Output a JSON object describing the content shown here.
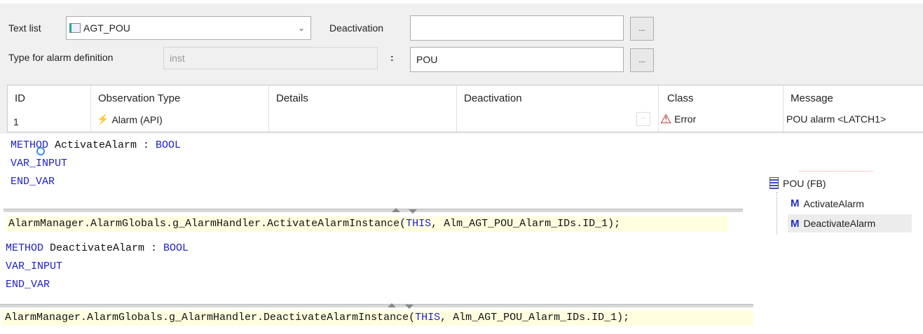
{
  "form": {
    "text_list_label": "Text list",
    "text_list_value": "AGT_POU",
    "deactivation_label": "Deactivation",
    "deactivation_value": "",
    "type_label": "Type for alarm definition",
    "type_value": "inst",
    "colon": ":",
    "pou_value": "POU",
    "dots": "..."
  },
  "table": {
    "columns": [
      "ID",
      "Observation Type",
      "Details",
      "Deactivation",
      "Class",
      "Message"
    ],
    "rows": [
      {
        "id": "1",
        "observation_type": "Alarm (API)",
        "details": "",
        "deactivation": "",
        "class": "Error",
        "message": "POU alarm <LATCH1>"
      }
    ]
  },
  "code": {
    "method1": {
      "kw": "METHOD",
      "name": " ActivateAlarm : ",
      "type": "BOOL",
      "var_input": "VAR_INPUT",
      "end_var": "END_VAR",
      "impl_a": "AlarmManager.AlarmGlobals.g_AlarmHandler.ActivateAlarmInstance(",
      "impl_this": "THIS",
      "impl_b": ", Alm_AGT_POU_Alarm_IDs.ID_1);"
    },
    "method2": {
      "kw": "METHOD",
      "name": " DeactivateAlarm : ",
      "type": "BOOL",
      "var_input": "VAR_INPUT",
      "end_var": "END_VAR",
      "impl_a": "AlarmManager.AlarmGlobals.g_AlarmHandler.DeactivateAlarmInstance(",
      "impl_this": "THIS",
      "impl_b": ", Alm_AGT_POU_Alarm_IDs.ID_1);"
    }
  },
  "tree": {
    "root": "POU (FB)",
    "children": [
      "ActivateAlarm",
      "DeactivateAlarm"
    ],
    "selected": "DeactivateAlarm"
  },
  "colors": {
    "keyword": "#2020c8",
    "highlight": "#ffffe0",
    "panel": "#f0f0f0",
    "error": "#b01010"
  }
}
